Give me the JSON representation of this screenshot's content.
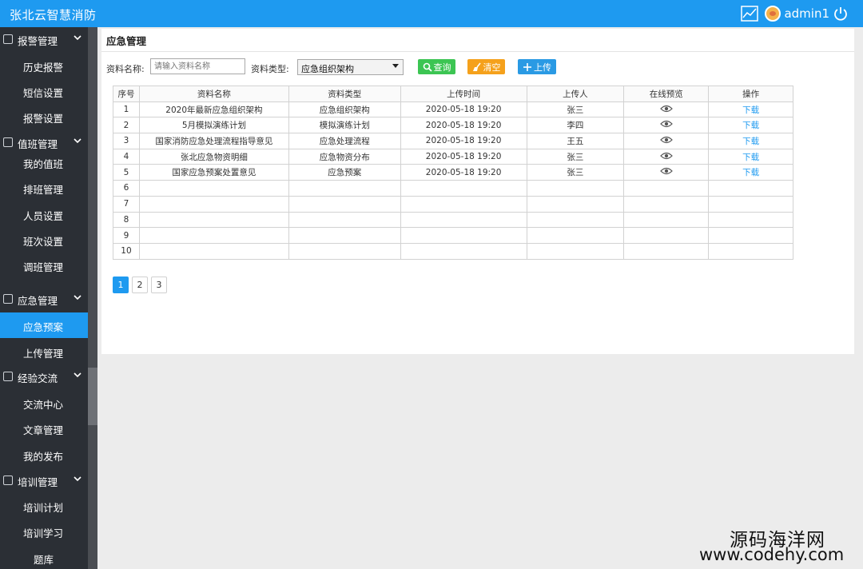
{
  "header": {
    "brand": "张北云智慧消防",
    "username": "admin1"
  },
  "sidebar": {
    "groups": [
      {
        "label": "报警管理",
        "icon": "home-icon",
        "items": [
          "历史报警",
          "短信设置",
          "报警设置"
        ]
      },
      {
        "label": "值班管理",
        "icon": "duty-icon",
        "items": [
          "我的值班",
          "排班管理",
          "人员设置",
          "班次设置",
          "调班管理"
        ]
      },
      {
        "label": "应急管理",
        "icon": "emergency-icon",
        "items": [
          "应急预案",
          "上传管理"
        ]
      },
      {
        "label": "经验交流",
        "icon": "chat-icon",
        "items": [
          "交流中心",
          "文章管理",
          "我的发布"
        ]
      },
      {
        "label": "培训管理",
        "icon": "training-icon",
        "items": [
          "培训计划",
          "培训学习",
          "题库"
        ]
      }
    ],
    "active": "应急预案"
  },
  "page": {
    "title": "应急管理",
    "filters": {
      "name_label": "资料名称:",
      "name_placeholder": "请输入资料名称",
      "type_label": "资料类型:",
      "type_value": "应急组织架构"
    },
    "buttons": {
      "query": "查询",
      "clear": "清空",
      "upload": "上传"
    }
  },
  "table": {
    "columns": [
      "序号",
      "资料名称",
      "资料类型",
      "上传时间",
      "上传人",
      "在线预览",
      "操作"
    ],
    "rows": [
      {
        "no": "1",
        "name": "2020年最新应急组织架构",
        "type": "应急组织架构",
        "time": "2020-05-18  19:20",
        "uploader": "张三",
        "action": "下载"
      },
      {
        "no": "2",
        "name": "5月模拟演练计划",
        "type": "模拟演练计划",
        "time": "2020-05-18  19:20",
        "uploader": "李四",
        "action": "下载"
      },
      {
        "no": "3",
        "name": "国家消防应急处理流程指导意见",
        "type": "应急处理流程",
        "time": "2020-05-18  19:20",
        "uploader": "王五",
        "action": "下载"
      },
      {
        "no": "4",
        "name": "张北应急物资明细",
        "type": "应急物资分布",
        "time": "2020-05-18  19:20",
        "uploader": "张三",
        "action": "下载"
      },
      {
        "no": "5",
        "name": "国家应急预案处置意见",
        "type": "应急预案",
        "time": "2020-05-18  19:20",
        "uploader": "张三",
        "action": "下载"
      },
      {
        "no": "6"
      },
      {
        "no": "7"
      },
      {
        "no": "8"
      },
      {
        "no": "9"
      },
      {
        "no": "10"
      }
    ]
  },
  "pagination": {
    "pages": [
      "1",
      "2",
      "3"
    ],
    "current": "1"
  },
  "watermark": {
    "line1": "源码海洋网",
    "line2": "www.codehy.com"
  },
  "colors": {
    "primary": "#1e9af0",
    "query": "#3cc553",
    "clear": "#f5a11c",
    "upload": "#2a9ae4",
    "sidebar": "#2b2f35"
  }
}
